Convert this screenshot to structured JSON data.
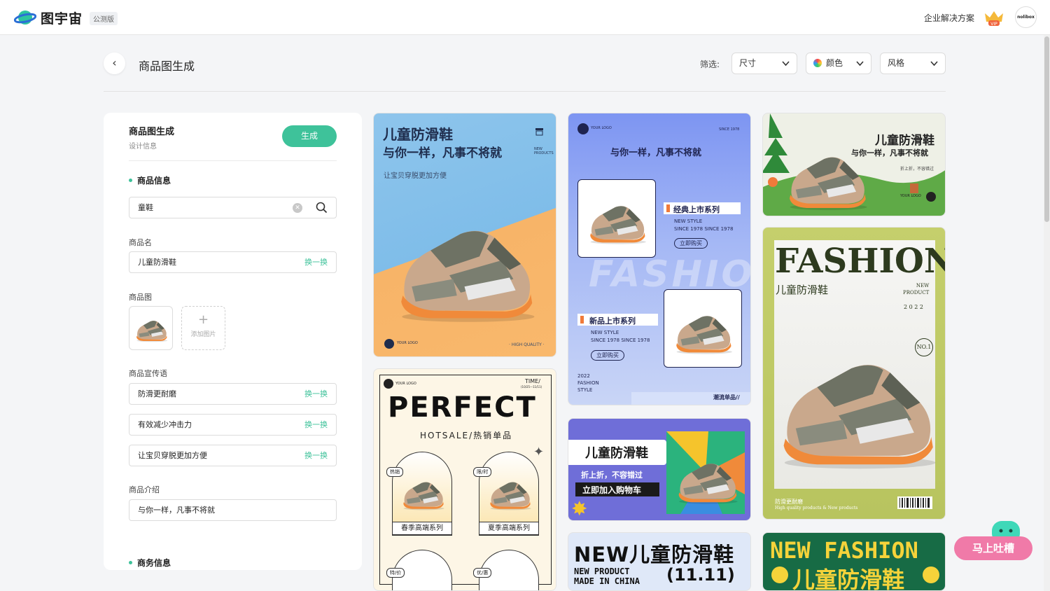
{
  "app": {
    "name": "图宇宙",
    "beta": "公测版",
    "enterprise_link": "企业解决方案",
    "vip": "VIP",
    "avatar_text": "nolibox"
  },
  "header": {
    "title": "商品图生成",
    "filter_label": "筛选:",
    "filters": [
      "尺寸",
      "颜色",
      "风格"
    ]
  },
  "panel": {
    "title": "商品图生成",
    "subtitle": "设计信息",
    "generate_label": "生成",
    "section_product": "商品信息",
    "search_value": "童鞋",
    "name_label": "商品名",
    "name_value": "儿童防滑鞋",
    "swap_label": "换一换",
    "image_label": "商品图",
    "add_image_label": "添加图片",
    "slogan_label": "商品宣传语",
    "slogans": [
      "防滑更耐磨",
      "有效减少冲击力",
      "让宝贝穿脱更加方便"
    ],
    "intro_label": "商品介绍",
    "intro_value": "与你一样，凡事不将就",
    "section_business": "商务信息"
  },
  "cards": {
    "c1": {
      "title": "儿童防滑鞋",
      "subtitle": "与你一样，凡事不将就",
      "new": "NEW",
      "products": "PRODUCTS",
      "tagline": "让宝贝穿脱更加方便",
      "logo": "YOUR LOGO",
      "quality": "· HIGH QUALITY ·"
    },
    "c2": {
      "logo": "YOUR LOGO",
      "since": "SINCE 1978",
      "slogan": "与你一样，凡事不将就",
      "series1": "经典上市系列",
      "series2": "新品上市系列",
      "newstyle": "NEW STYLE",
      "since_line": "SINCE 1978 SINCE 1978",
      "buy": "立即购买",
      "fashion": "FASHION",
      "year": "2022",
      "fashion2": "FASHION",
      "style": "STYLE",
      "trend": "潮流单品//"
    },
    "c3": {
      "title": "儿童防滑鞋",
      "subtitle": "与你一样，凡事不将就",
      "small": "折上折，不容错过",
      "logo": "YOUR LOGO"
    },
    "c4": {
      "logo": "YOUR LOGO",
      "time": "TIME/",
      "date": "(10/25—11/11)",
      "perfect": "PERFECT",
      "hotsale": "HOTSALE/热销单品",
      "tag1": "热销",
      "tag2": "限/时",
      "tag3": "特/价",
      "tag4": "优/惠",
      "series_spring": "春季高端系列",
      "series_summer": "夏季高端系列"
    },
    "c5": {
      "fashion": "FASHION",
      "title": "儿童防滑鞋",
      "new": "NEW",
      "product": "PRODUCT",
      "year": "2 0 2 2",
      "no1": "NO.1",
      "bottom1": "防滑更耐磨",
      "bottom2": "High quality products & New products"
    },
    "c6": {
      "title": "儿童防滑鞋",
      "discount": "折上折，不容错过",
      "cart": "立即加入购物车"
    },
    "c7": {
      "title": "NEW儿童防滑鞋",
      "np": "NEW PRODUCT",
      "made": "MADE IN CHINA",
      "date": "(11.11)"
    },
    "c8": {
      "line1": "NEW FASHION",
      "line2": "儿童防滑鞋"
    }
  },
  "feedback": {
    "label": "马上吐槽"
  }
}
